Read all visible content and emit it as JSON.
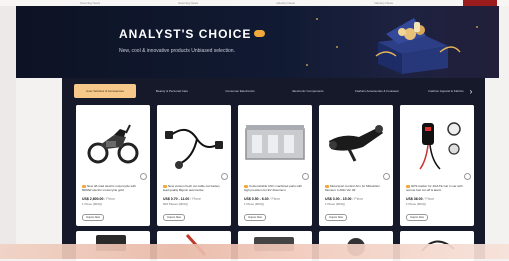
{
  "topbar": {
    "links": [
      "Sourcing News",
      "Sourcing News",
      "Industry News",
      "Industry News"
    ]
  },
  "hero": {
    "title": "ANALYST'S CHOICE",
    "subtitle": "New, cool & innovative products Unbiased selection."
  },
  "tabs": {
    "items": [
      "Auto Vehicles & Accessories",
      "Beauty & Personal Care",
      "Consumer Electronics",
      "Electronic Components",
      "Fashion Accessories & Footwear",
      "Fashion Apparel & Fabrics"
    ],
    "active_index": 0,
    "next_arrow": "›"
  },
  "products": [
    {
      "title": "New off-road electric motorcycle with 8000W electric motorcycle gold",
      "price": "US$ 2,600.00",
      "unit": "/ Piece",
      "moq": "1 Piece (MOQ)",
      "button": "Inquire Now"
    },
    {
      "title": "New version fresh cut cable car battery lead quality Bigmin automotive",
      "price": "US$ 0.70 - 11.00",
      "unit": "/ Piece",
      "moq": "500 Pieces (MOQ)",
      "button": "Inquire Now"
    },
    {
      "title": "Customizable CNC machined parts with high precision for EV Aluminum",
      "price": "US$ 0.50 - 6.30",
      "unit": "/ Piece",
      "moq": "1 Piece (MOQ)",
      "button": "Inquire Now"
    },
    {
      "title": "Motorsport Control Arm for Mitsubishi Montero 4 2011 Ver 09",
      "price": "US$ 3.00 - 15.00",
      "unit": "/ Piece",
      "moq": "1 Piece (MOQ)",
      "button": "Inquire Now"
    },
    {
      "title": "GPS tracker for 4G/LTE Car in car with remote fuel cut-off & alarm",
      "price": "US$ 36.00",
      "unit": "/ Piece",
      "moq": "1 Piece (MOQ)",
      "button": "Inquire Now"
    }
  ],
  "colors": {
    "hero_bg": "#0d1324",
    "content_bg": "#15192a",
    "tab_active": "#f6c98a",
    "badge": "#f2a93b"
  }
}
